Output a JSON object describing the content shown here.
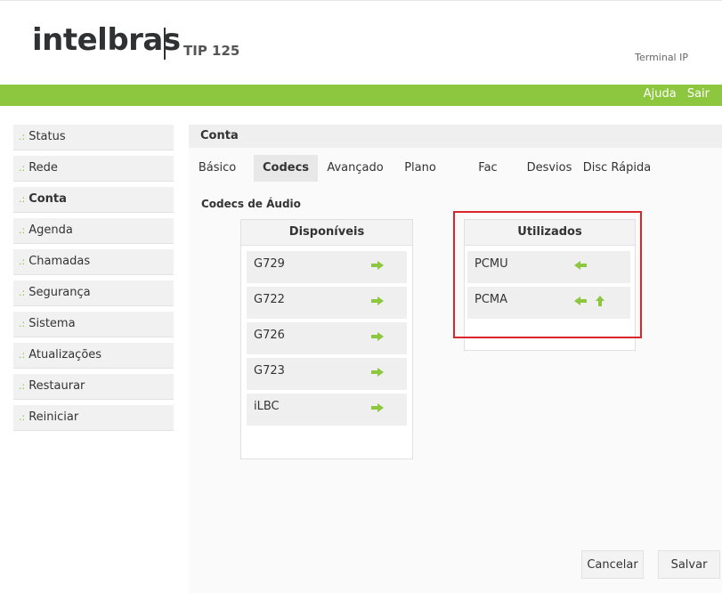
{
  "header": {
    "logo": "intelbras",
    "model": "TIP 125",
    "subtitle": "Terminal IP",
    "links": [
      "Ajuda",
      "Sair"
    ]
  },
  "sidebar": {
    "items": [
      {
        "prefix": ".:",
        "label": "Status"
      },
      {
        "prefix": ".:",
        "label": "Rede"
      },
      {
        "prefix": ".:",
        "label": "Conta"
      },
      {
        "prefix": ".:",
        "label": "Agenda"
      },
      {
        "prefix": ".:",
        "label": "Chamadas"
      },
      {
        "prefix": ".:",
        "label": "Segurança"
      },
      {
        "prefix": ".:",
        "label": "Sistema"
      },
      {
        "prefix": ".:",
        "label": "Atualizações"
      },
      {
        "prefix": ".:",
        "label": "Restaurar"
      },
      {
        "prefix": ".:",
        "label": "Reiniciar"
      }
    ],
    "active": "Conta"
  },
  "main": {
    "title": "Conta",
    "tabs": [
      "Básico",
      "Codecs",
      "Avançado",
      "Plano",
      "Fac",
      "Desvios",
      "Disc Rápida"
    ],
    "active_tab": "Codecs",
    "section_title": "Codecs de Áudio",
    "available": {
      "title": "Disponíveis",
      "codecs": [
        "G729",
        "G722",
        "G726",
        "G723",
        "iLBC"
      ]
    },
    "used": {
      "title": "Utilizados",
      "codecs": [
        "PCMU",
        "PCMA"
      ]
    },
    "buttons": {
      "cancel": "Cancelar",
      "save": "Salvar"
    }
  },
  "colors": {
    "brand_green": "#8dc63f",
    "arrow_green": "#8dc63f",
    "highlight_red": "#d9262b"
  },
  "icons": {
    "add": "arrow-right-icon",
    "remove": "arrow-left-icon",
    "move_up": "arrow-up-icon"
  }
}
